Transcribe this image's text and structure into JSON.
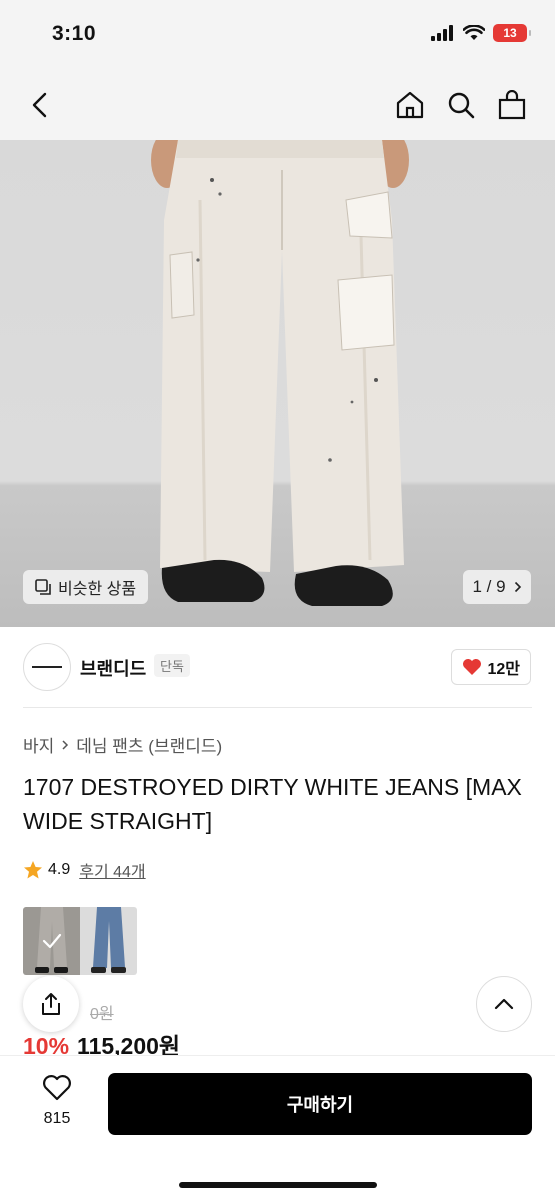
{
  "status": {
    "time": "3:10",
    "battery": "13"
  },
  "hero": {
    "similar_label": "비슷한 상품",
    "counter": "1 / 9"
  },
  "brand": {
    "name": "브랜디드",
    "tag": "단독",
    "likes": "12만"
  },
  "breadcrumb": {
    "category": "바지",
    "subcategory": "데님 팬츠 (브랜디드)"
  },
  "product": {
    "title": "1707 DESTROYED DIRTY WHITE JEANS [MAX WIDE STRAIGHT]",
    "rating": "4.9",
    "reviews": "후기 44개",
    "original_price": "0원",
    "discount": "10%",
    "price": "115,200원"
  },
  "bottom_bar": {
    "wish_count": "815",
    "buy_label": "구매하기"
  },
  "colors": {
    "accent": "#e53935",
    "buy_button": "#000000",
    "star": "#f5a623"
  },
  "icons": [
    "back-icon",
    "home-icon",
    "search-icon",
    "bag-icon",
    "similar-icon",
    "chevron-right-icon",
    "heart-icon",
    "star-icon",
    "share-icon",
    "chevron-up-icon",
    "check-icon"
  ]
}
